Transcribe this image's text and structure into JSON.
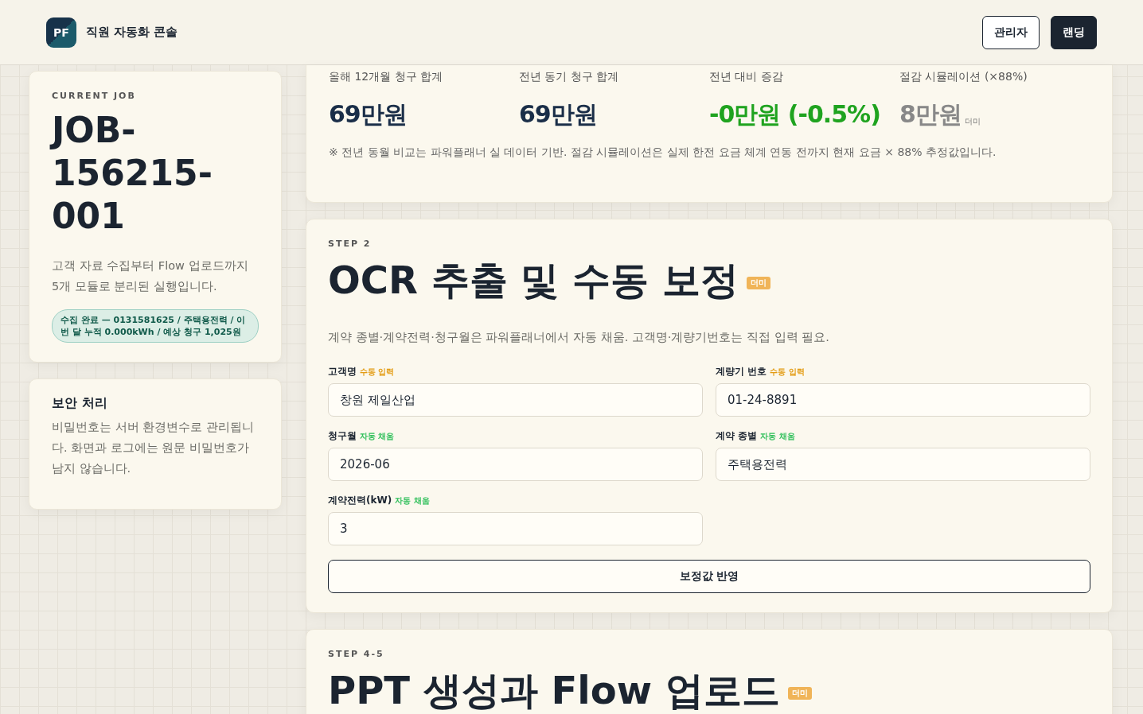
{
  "header": {
    "logo": "PF",
    "title": "직원 자동화 콘솔",
    "buttons": [
      {
        "label": "관리자",
        "kind": "outline"
      },
      {
        "label": "랜딩",
        "kind": "solid"
      }
    ]
  },
  "job": {
    "eyebrow": "CURRENT JOB",
    "id": "JOB-156215-001",
    "description": "고객 자료 수집부터 Flow 업로드까지 5개 모듈로 분리된 실행입니다.",
    "status": "수집 완료 — 0131581625 / 주택용전력 / 이번 달 누적 0.000kWh / 예상 청구 1,025원"
  },
  "security": {
    "title": "보안 처리",
    "text": "비밀번호는 서버 환경변수로 관리됩니다. 화면과 로그에는 원문 비밀번호가 남지 않습니다."
  },
  "stats": {
    "items": [
      {
        "label": "올해 12개월 청구 합계",
        "value": "69만원",
        "kind": "normal"
      },
      {
        "label": "전년 동기 청구 합계",
        "value": "69만원",
        "kind": "normal"
      },
      {
        "label": "전년 대비 증감",
        "value": "-0만원 (-0.5%)",
        "kind": "change"
      },
      {
        "label": "절감 시뮬레이션 (×88%)",
        "value": "8만원",
        "kind": "dummy",
        "badge": "더미"
      }
    ],
    "note": "※ 전년 동월 비교는 파워플래너 실 데이터 기반. 절감 시뮬레이션은 실제 한전 요금 체계 연동 전까지 현재 요금 × 88% 추정값입니다."
  },
  "ocr": {
    "step": "STEP 2",
    "title": "OCR 추출 및 수동 보정",
    "badge": "더미",
    "description": "계약 종별·계약전력·청구월은 파워플래너에서 자동 채움. 고객명·계량기번호는 직접 입력 필요.",
    "fields": [
      {
        "label": "고객명",
        "source": "수동 입력",
        "kind": "manual",
        "value": "창원 제일산업"
      },
      {
        "label": "계량기 번호",
        "source": "수동 입력",
        "kind": "manual",
        "value": "01-24-8891"
      },
      {
        "label": "청구월",
        "source": "자동 채움",
        "kind": "auto",
        "value": "2026-06"
      },
      {
        "label": "계약 종별",
        "source": "자동 채움",
        "kind": "auto",
        "value": "주택용전력"
      },
      {
        "label": "계약전력(kW)",
        "source": "자동 채움",
        "kind": "auto",
        "value": "3"
      }
    ],
    "apply_button": "보정값 반영"
  },
  "ppt": {
    "step": "STEP 4-5",
    "title": "PPT 생성과 Flow 업로드",
    "badge": "더미"
  }
}
